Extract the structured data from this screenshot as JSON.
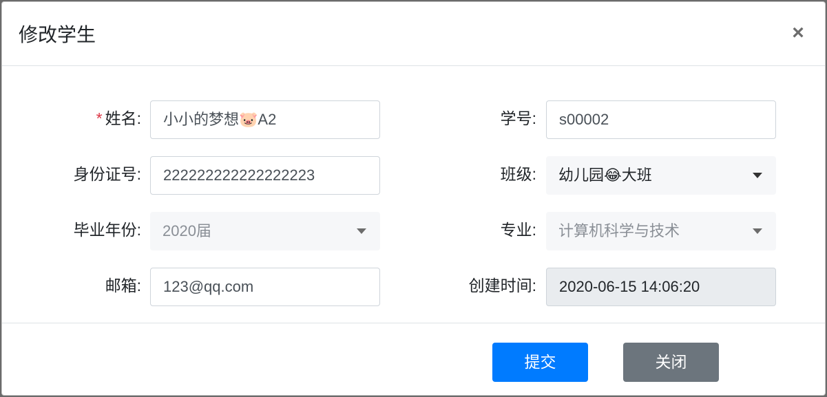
{
  "dialog": {
    "title": "修改学生",
    "close_label": "×"
  },
  "form": {
    "name": {
      "label": "姓名:",
      "required_mark": "*",
      "value": "小小的梦想🐷A2"
    },
    "student_no": {
      "label": "学号:",
      "value": "s00002"
    },
    "id_card": {
      "label": "身份证号:",
      "value": "222222222222222223"
    },
    "class": {
      "label": "班级:",
      "value": "幼儿园😂大班"
    },
    "grad_year": {
      "label": "毕业年份:",
      "value": "2020届"
    },
    "major": {
      "label": "专业:",
      "value": "计算机科学与技术"
    },
    "email": {
      "label": "邮箱:",
      "value": "123@qq.com"
    },
    "created_at": {
      "label": "创建时间:",
      "value": "2020-06-15 14:06:20"
    }
  },
  "footer": {
    "submit_label": "提交",
    "close_label": "关闭"
  },
  "colors": {
    "primary": "#007bff",
    "secondary": "#6c757d",
    "required": "#dc3545"
  }
}
